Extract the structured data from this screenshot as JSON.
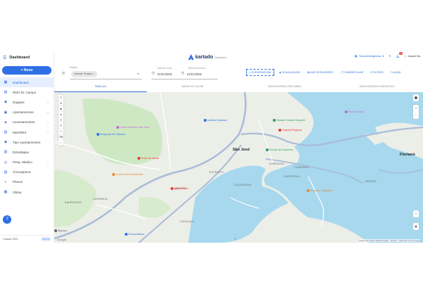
{
  "sidebar": {
    "title": "Dashboard",
    "new_button": "Novo",
    "items": [
      {
        "label": "Dashboard",
        "icon": "dashboard-icon",
        "glyph": "▦",
        "active": true,
        "chevron": false
      },
      {
        "label": "RDO Di. Campo",
        "icon": "document-icon",
        "glyph": "▤",
        "active": false,
        "chevron": false
      },
      {
        "label": "Equipes",
        "icon": "team-icon",
        "glyph": "◉",
        "active": false,
        "chevron": true
      },
      {
        "label": "Apontamentos",
        "icon": "clipboard-icon",
        "glyph": "▣",
        "active": false,
        "chevron": true
      },
      {
        "label": "Levantamentos",
        "icon": "survey-icon",
        "glyph": "◈",
        "active": false,
        "chevron": true
      },
      {
        "label": "Metrô/Rd",
        "icon": "train-icon",
        "glyph": "▥",
        "active": false,
        "chevron": true
      },
      {
        "label": "Tipo Apontamentos",
        "icon": "tag-icon",
        "glyph": "◆",
        "active": false,
        "chevron": false
      },
      {
        "label": "Estratégias",
        "icon": "strategy-icon",
        "glyph": "▧",
        "active": false,
        "chevron": false
      },
      {
        "label": "Pesq. Médico",
        "icon": "search-icon",
        "glyph": "◎",
        "active": false,
        "chevron": true
      },
      {
        "label": "Cronograma",
        "icon": "calendar-icon",
        "glyph": "▨",
        "active": false,
        "chevron": false
      },
      {
        "label": "Planos",
        "icon": "plan-icon",
        "glyph": "◐",
        "active": false,
        "chevron": false
      },
      {
        "label": "Obras",
        "icon": "building-icon",
        "glyph": "▩",
        "active": false,
        "chevron": false
      }
    ],
    "footer_label": "Cidade 2025",
    "footer_tag": "v2.0.4",
    "fab_icon": "help-icon"
  },
  "topbar": {
    "logo_name": "kartado",
    "logo_sub": "Dashboard",
    "workspace": "Tecnolinteligência",
    "notifications": "11",
    "user": "Joacid.Ha"
  },
  "filters": {
    "region_label": "Região",
    "region_value": "Grande Floripa",
    "date_start_label": "Data de início",
    "date_start": "01/01/2025",
    "date_end_label": "Data de término",
    "date_end": "31/01/2025",
    "actions": [
      {
        "label": "EXPORTAR KML",
        "icon": "export-icon",
        "selected": true
      },
      {
        "label": "VISUALIZAÇÃO",
        "icon": "eye-icon",
        "selected": false
      },
      {
        "label": "ADD SERVIDORES",
        "icon": "server-icon",
        "selected": false
      },
      {
        "label": "COMPARTILHAR",
        "icon": "share-icon",
        "selected": false
      },
      {
        "label": "FILTROS",
        "icon": "filter-icon",
        "selected": false
      },
      {
        "label": "AJUDA",
        "icon": "help-icon",
        "selected": false
      }
    ]
  },
  "tabs": [
    {
      "label": "TABELAS",
      "active": true
    },
    {
      "label": "MAPA DE CALOR",
      "active": false
    },
    {
      "label": "INDICADORES POR ÁREA",
      "active": false
    },
    {
      "label": "INDICADORES LIMITANTES",
      "active": false
    }
  ],
  "map": {
    "city_main": "São José",
    "city_right": "Florianó",
    "areas": [
      "KOBRASOL",
      "CAMPINAS",
      "CAPOEIRAS",
      "ESTREITO",
      "COQUEIROS",
      "ABRAÃO",
      "CENTRO",
      "BARREIROS",
      "SERRARIA",
      "ITAGUAÇU"
    ],
    "pois": [
      {
        "label": "Centro Histórico São José",
        "color": "#c26ad6"
      },
      {
        "label": "Shopping Via Catarina",
        "color": "#2f6fe6"
      },
      {
        "label": "Instituto Estadual",
        "color": "#2f6fe6"
      },
      {
        "label": "Estádio Orlando Scarpelli",
        "color": "#2e9e55"
      },
      {
        "label": "Hospital Regional",
        "color": "#e53935"
      },
      {
        "label": "Parque de Coqueiros",
        "color": "#2e9e55"
      },
      {
        "label": "Angeloni Capoeiras",
        "color": "#e8892e"
      },
      {
        "label": "Praia do Meio",
        "color": "#c26ad6"
      },
      {
        "label": "Condomínio Residencial",
        "color": "#e8892e"
      },
      {
        "label": "Igreja Matriz",
        "color": "#e53935"
      },
      {
        "label": "Posto de Saúde",
        "color": "#e53935"
      },
      {
        "label": "Escola Básica",
        "color": "#2f6fe6"
      },
      {
        "label": "Biguaçu",
        "color": "#666666"
      }
    ],
    "attribution": "Dados do mapa ©2025 Google · Termos · Informar erro no mapa",
    "google": "Google",
    "zoom_in": "+",
    "zoom_out": "−"
  },
  "colors": {
    "accent": "#2f6fe6",
    "water": "#a7d8ee",
    "land": "#eceee8",
    "park": "#cfe8c4",
    "road": "#ffffff",
    "highway": "#a9bcd8"
  }
}
